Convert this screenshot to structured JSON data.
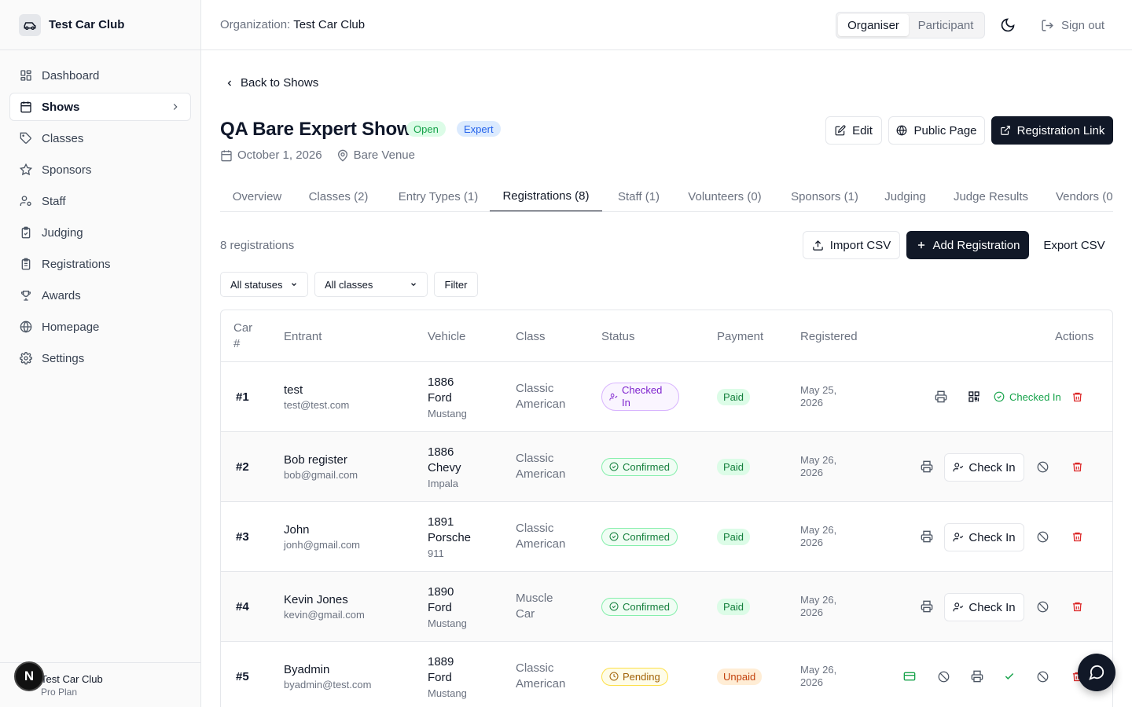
{
  "app": {
    "name": "Test Car Club"
  },
  "sidebar": {
    "items": [
      {
        "label": "Dashboard",
        "icon": "dashboard-icon"
      },
      {
        "label": "Shows",
        "icon": "calendar-icon",
        "active": true
      },
      {
        "label": "Classes",
        "icon": "tag-icon"
      },
      {
        "label": "Sponsors",
        "icon": "star-icon"
      },
      {
        "label": "Staff",
        "icon": "user-cog-icon"
      },
      {
        "label": "Judging",
        "icon": "clipboard-check-icon"
      },
      {
        "label": "Registrations",
        "icon": "clipboard-list-icon"
      },
      {
        "label": "Awards",
        "icon": "trophy-icon"
      },
      {
        "label": "Homepage",
        "icon": "globe-icon"
      },
      {
        "label": "Settings",
        "icon": "gear-icon"
      }
    ],
    "footer": {
      "name": "Test Car Club",
      "plan": "Pro Plan",
      "avatar_letter": "N"
    }
  },
  "topbar": {
    "org_label": "Organization:",
    "org_value": "Test Car Club",
    "roles": [
      "Organiser",
      "Participant"
    ],
    "active_role": "Organiser",
    "sign_out": "Sign out"
  },
  "show": {
    "back": "Back to Shows",
    "title": "QA Bare Expert Show",
    "status_badge": "Open",
    "level_badge": "Expert",
    "date": "October 1, 2026",
    "venue": "Bare Venue",
    "actions": {
      "edit": "Edit",
      "public_page": "Public Page",
      "registration_link": "Registration Link"
    }
  },
  "tabs": [
    {
      "label": "Overview"
    },
    {
      "label": "Classes (2)"
    },
    {
      "label": "Entry Types (1)"
    },
    {
      "label": "Registrations (8)",
      "active": true
    },
    {
      "label": "Staff (1)"
    },
    {
      "label": "Volunteers (0)"
    },
    {
      "label": "Sponsors (1)"
    },
    {
      "label": "Judging"
    },
    {
      "label": "Judge Results"
    },
    {
      "label": "Vendors (0"
    }
  ],
  "registrations": {
    "count_text": "8 registrations",
    "import_csv": "Import CSV",
    "add_registration": "Add Registration",
    "export_csv": "Export CSV",
    "filters": {
      "status": "All statuses",
      "class": "All classes",
      "filter_button": "Filter"
    },
    "columns": {
      "car_a": "Car",
      "car_b": "#",
      "entrant": "Entrant",
      "vehicle": "Vehicle",
      "class": "Class",
      "status": "Status",
      "payment": "Payment",
      "registered": "Registered",
      "actions": "Actions"
    },
    "check_in_label": "Check In",
    "checked_in_label": "Checked In",
    "rows": [
      {
        "car": "#1",
        "name": "test",
        "email": "test@test.com",
        "year": "1886",
        "make": "Ford",
        "model": "Mustang",
        "class_a": "Classic",
        "class_b": "American",
        "status_a": "Checked",
        "status_b": "In",
        "status_type": "checked",
        "payment": "Paid",
        "date_a": "May 25,",
        "date_b": "2026"
      },
      {
        "car": "#2",
        "name": "Bob register",
        "email": "bob@gmail.com",
        "year": "1886",
        "make": "Chevy",
        "model": "Impala",
        "class_a": "Classic",
        "class_b": "American",
        "status": "Confirmed",
        "status_type": "confirmed",
        "payment": "Paid",
        "date_a": "May 26,",
        "date_b": "2026"
      },
      {
        "car": "#3",
        "name": "John",
        "email": "jonh@gmail.com",
        "year": "1891",
        "make": "Porsche",
        "model": "911",
        "class_a": "Classic",
        "class_b": "American",
        "status": "Confirmed",
        "status_type": "confirmed",
        "payment": "Paid",
        "date_a": "May 26,",
        "date_b": "2026"
      },
      {
        "car": "#4",
        "name": "Kevin Jones",
        "email": "kevin@gmail.com",
        "year": "1890",
        "make": "Ford",
        "model": "Mustang",
        "class_a": "Muscle",
        "class_b": "Car",
        "status": "Confirmed",
        "status_type": "confirmed",
        "payment": "Paid",
        "date_a": "May 26,",
        "date_b": "2026"
      },
      {
        "car": "#5",
        "name": "Byadmin",
        "email": "byadmin@test.com",
        "year": "1889",
        "make": "Ford",
        "model": "Mustang",
        "class_a": "Classic",
        "class_b": "American",
        "status": "Pending",
        "status_type": "pending",
        "payment": "Unpaid",
        "date_a": "May 26,",
        "date_b": "2026"
      }
    ]
  },
  "colors": {
    "primary": "#111827",
    "green": "#16a34a",
    "red": "#dc2626",
    "purple": "#7e22ce",
    "amber": "#a16207"
  }
}
